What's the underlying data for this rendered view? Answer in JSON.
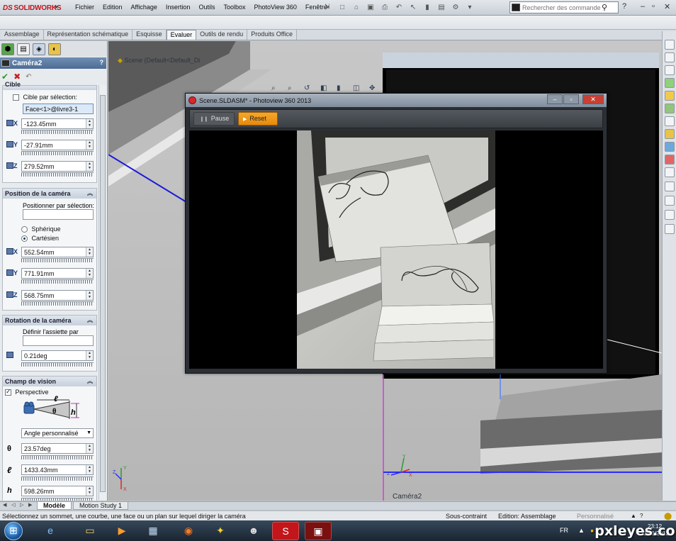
{
  "app": {
    "logo_prefix": "DS",
    "logo_name": "SOLIDWORKS",
    "menu": [
      "Fichier",
      "Edition",
      "Affichage",
      "Insertion",
      "Outils",
      "Toolbox",
      "PhotoView 360",
      "Fenêtre"
    ],
    "search_placeholder": "Rechercher des commandes"
  },
  "tabs": [
    "Assemblage",
    "Représentation schématique",
    "Esquisse",
    "Evaluer",
    "Outils de rendu",
    "Produits Office"
  ],
  "active_tab": "Evaluer",
  "property_manager": {
    "title": "Caméra2",
    "help": "?",
    "target_group": {
      "title": "Cible",
      "checkbox_label": "Cible par sélection:",
      "selection": "Face<1>@livre3-1",
      "x": "-123.45mm",
      "y": "-27.91mm",
      "z": "279.52mm"
    },
    "position_group": {
      "title": "Position de la caméra",
      "select_label": "Positionner par sélection:",
      "selection": "",
      "option_spherical": "Sphérique",
      "option_cartesian": "Cartésien",
      "x": "552.54mm",
      "y": "771.91mm",
      "z": "568.75mm"
    },
    "rotation_group": {
      "title": "Rotation de la caméra",
      "define_label": "Définir l'assiette par",
      "selection": "",
      "roll": "0.21deg"
    },
    "fov_group": {
      "title": "Champ de vision",
      "perspective_label": "Perspective",
      "diagram_l": "ℓ",
      "diagram_theta": "θ",
      "diagram_h": "h",
      "preset": "Angle personnalisé",
      "theta_symbol": "θ",
      "theta": "23.57deg",
      "l_symbol": "ℓ",
      "l": "1433.43mm",
      "h_symbol": "h",
      "h": "598.26mm"
    },
    "axis_labels": {
      "x": "X",
      "y": "Y",
      "z": "Z"
    }
  },
  "viewport": {
    "tree_label": "Scene (Default<Default_Di",
    "camera_label": "Caméra2"
  },
  "photoview": {
    "title": "Scene.SLDASM* - Photoview 360 2013",
    "pause_label": "Pause",
    "reset_label": "Reset"
  },
  "bottom_tabs": [
    "Modèle",
    "Motion Study 1"
  ],
  "status": {
    "message": "Sélectionnez un sommet, une courbe, une face ou un plan sur lequel diriger la caméra",
    "constraint": "Sous-contraint",
    "mode": "Edition: Assemblage",
    "personalized": "Personnalisé"
  },
  "taskbar": {
    "lang": "FR",
    "time": "23:12",
    "date": "23/01/2013",
    "watermark_pre": "",
    "watermark_brand": "pxleyes",
    "watermark_post": ".com"
  }
}
